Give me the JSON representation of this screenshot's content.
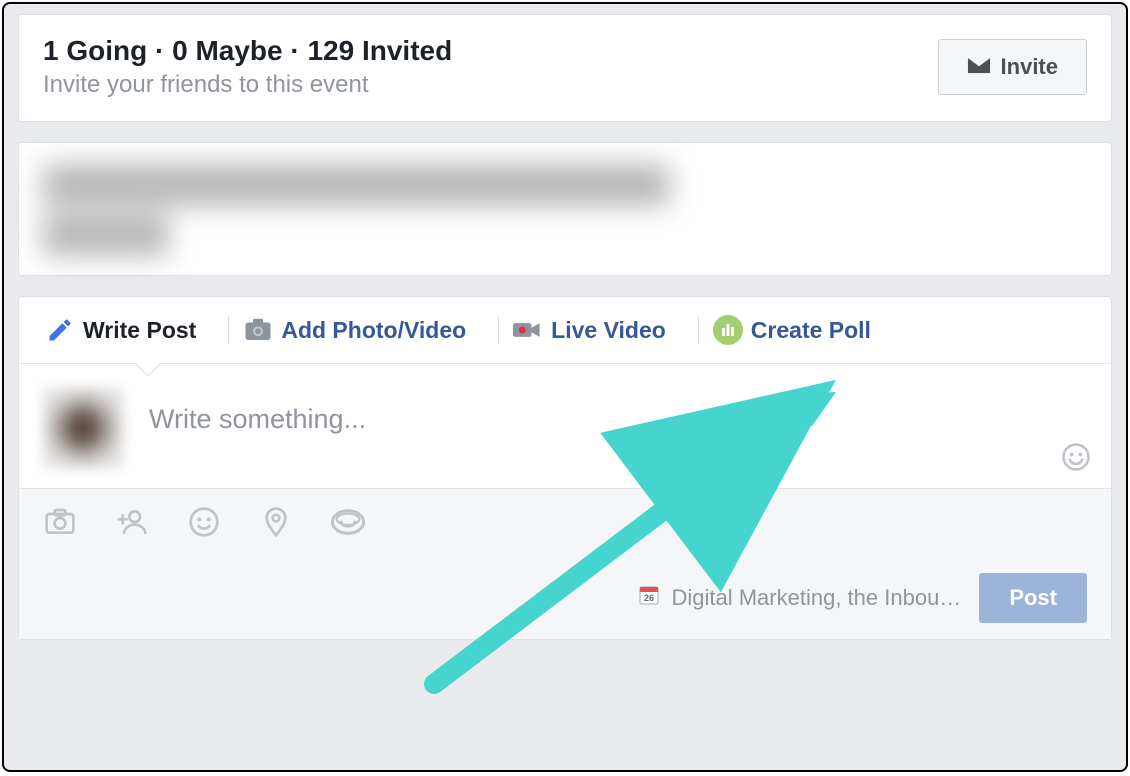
{
  "stats": {
    "summary": "1 Going · 0 Maybe · 129 Invited",
    "subtext": "Invite your friends to this event",
    "invite_label": "Invite"
  },
  "composer": {
    "tabs": {
      "write": "Write Post",
      "photo": "Add Photo/Video",
      "live": "Live Video",
      "poll": "Create Poll"
    },
    "placeholder": "Write something...",
    "event_tag": "Digital Marketing, the Inbou…",
    "post_label": "Post"
  }
}
